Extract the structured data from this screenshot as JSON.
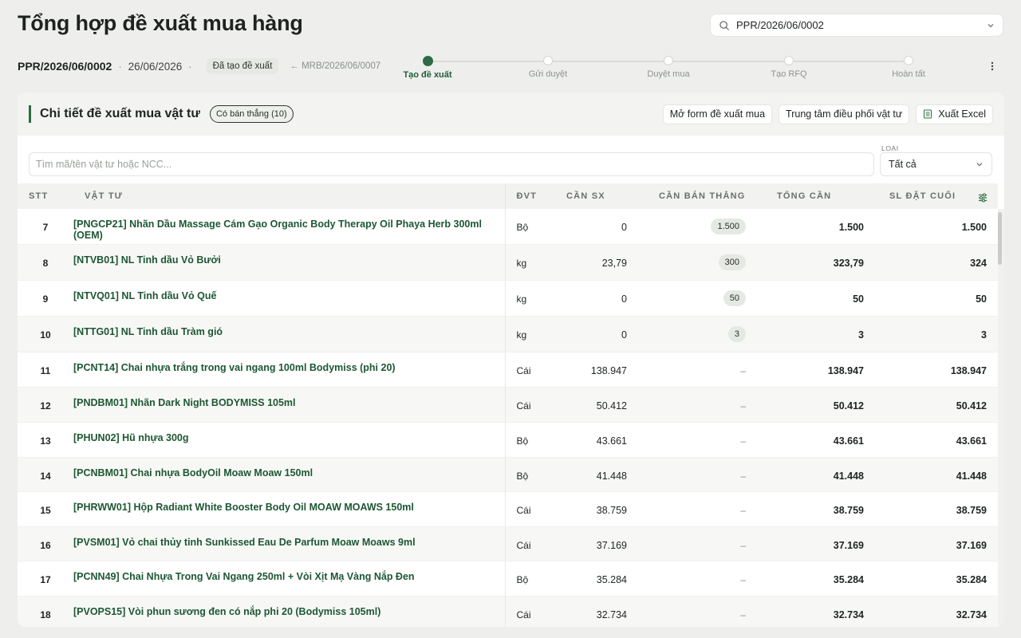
{
  "header": {
    "title": "Tổng hợp đề xuất mua hàng",
    "search_value": "PPR/2026/06/0002"
  },
  "meta": {
    "code": "PPR/2026/06/0002",
    "date": "26/06/2026",
    "status_badge": "Đã tạo đề xuất",
    "source_link": "← MRB/2026/06/0007"
  },
  "stepper": {
    "steps": [
      {
        "label": "Tạo đề xuất",
        "active": true
      },
      {
        "label": "Gửi duyệt",
        "active": false
      },
      {
        "label": "Duyệt mua",
        "active": false
      },
      {
        "label": "Tạo RFQ",
        "active": false
      },
      {
        "label": "Hoàn tất",
        "active": false
      }
    ]
  },
  "card": {
    "title": "Chi tiết đề xuất mua vật tư",
    "pill": "Có bán thẳng (10)",
    "buttons": {
      "open_form": "Mở form đề xuất mua",
      "dispatch_center": "Trung tâm điều phối vật tư",
      "export_excel": "Xuất Excel"
    },
    "filter": {
      "placeholder": "Tìm mã/tên vật tư hoặc NCC...",
      "type_label": "LOẠI",
      "type_value": "Tất cả"
    }
  },
  "table": {
    "columns": [
      "STT",
      "VẬT TƯ",
      "ĐVT",
      "CẦN SX",
      "CẦN BÁN THẲNG",
      "TỔNG CẦN",
      "SL ĐẶT CUỐI"
    ],
    "rows": [
      {
        "stt": "7",
        "name": "[PNGCP21] Nhãn Dầu Massage Cám Gạo Organic Body Therapy Oil Phaya Herb 300ml (OEM)",
        "dvt": "Bộ",
        "can_sx": "0",
        "can_ban_thang": "1.500",
        "tong_can": "1.500",
        "sl_dat_cuoi": "1.500"
      },
      {
        "stt": "8",
        "name": "[NTVB01] NL Tinh dầu Vỏ Bưởi",
        "dvt": "kg",
        "can_sx": "23,79",
        "can_ban_thang": "300",
        "tong_can": "323,79",
        "sl_dat_cuoi": "324"
      },
      {
        "stt": "9",
        "name": "[NTVQ01] NL Tinh dầu Vỏ Quế",
        "dvt": "kg",
        "can_sx": "0",
        "can_ban_thang": "50",
        "tong_can": "50",
        "sl_dat_cuoi": "50"
      },
      {
        "stt": "10",
        "name": "[NTTG01] NL Tinh dầu Tràm gió",
        "dvt": "kg",
        "can_sx": "0",
        "can_ban_thang": "3",
        "tong_can": "3",
        "sl_dat_cuoi": "3"
      },
      {
        "stt": "11",
        "name": "[PCNT14] Chai nhựa trắng trong vai ngang 100ml Bodymiss (phi 20)",
        "dvt": "Cái",
        "can_sx": "138.947",
        "can_ban_thang": "–",
        "tong_can": "138.947",
        "sl_dat_cuoi": "138.947"
      },
      {
        "stt": "12",
        "name": "[PNDBM01] Nhãn Dark Night BODYMISS 105ml",
        "dvt": "Cái",
        "can_sx": "50.412",
        "can_ban_thang": "–",
        "tong_can": "50.412",
        "sl_dat_cuoi": "50.412"
      },
      {
        "stt": "13",
        "name": "[PHUN02] Hũ nhựa 300g",
        "dvt": "Bộ",
        "can_sx": "43.661",
        "can_ban_thang": "–",
        "tong_can": "43.661",
        "sl_dat_cuoi": "43.661"
      },
      {
        "stt": "14",
        "name": "[PCNBM01] Chai nhựa BodyOil Moaw Moaw 150ml",
        "dvt": "Bộ",
        "can_sx": "41.448",
        "can_ban_thang": "–",
        "tong_can": "41.448",
        "sl_dat_cuoi": "41.448"
      },
      {
        "stt": "15",
        "name": "[PHRWW01] Hộp Radiant White Booster Body Oil MOAW MOAWS 150ml",
        "dvt": "Cái",
        "can_sx": "38.759",
        "can_ban_thang": "–",
        "tong_can": "38.759",
        "sl_dat_cuoi": "38.759"
      },
      {
        "stt": "16",
        "name": "[PVSM01] Vỏ chai thủy tinh Sunkissed Eau De Parfum Moaw Moaws 9ml",
        "dvt": "Cái",
        "can_sx": "37.169",
        "can_ban_thang": "–",
        "tong_can": "37.169",
        "sl_dat_cuoi": "37.169"
      },
      {
        "stt": "17",
        "name": "[PCNN49] Chai Nhựa Trong Vai Ngang 250ml + Vòi Xịt Mạ Vàng Nắp Đen",
        "dvt": "Bộ",
        "can_sx": "35.284",
        "can_ban_thang": "–",
        "tong_can": "35.284",
        "sl_dat_cuoi": "35.284"
      },
      {
        "stt": "18",
        "name": "[PVOPS15] Vòi phun sương đen có nắp phi 20 (Bodymiss 105ml)",
        "dvt": "Cái",
        "can_sx": "32.734",
        "can_ban_thang": "–",
        "tong_can": "32.734",
        "sl_dat_cuoi": "32.734"
      }
    ]
  },
  "icons": {
    "search": "search-icon",
    "chevron": "chevron-down-icon",
    "kebab": "kebab-menu-icon",
    "excel": "excel-file-icon",
    "columns_settings": "column-settings-icon"
  },
  "colors": {
    "accent": "#2c6a43",
    "link_text": "#1d5733",
    "background": "#eeefec"
  }
}
